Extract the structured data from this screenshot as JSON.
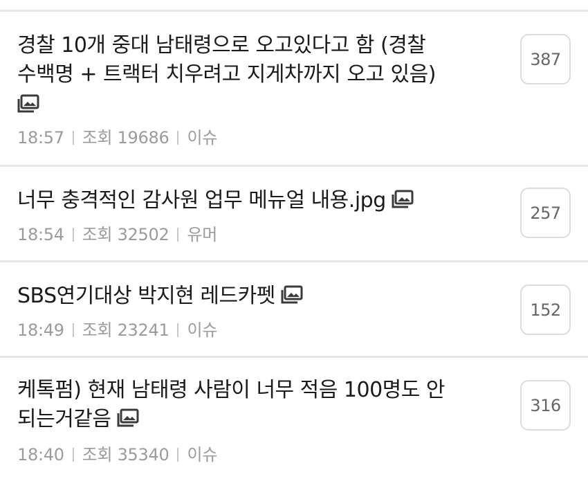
{
  "posts": [
    {
      "title_lines": [
        "경찰 10개 중대 남태령으로 오고있다고 함 (경찰",
        "수백명 + 트랙터 치우려고 지게차까지 오고 있음)"
      ],
      "has_image_icon": true,
      "time": "18:57",
      "views_label": "조회",
      "views": "19686",
      "category": "이슈",
      "comment_count": "387"
    },
    {
      "title_lines": [
        "너무 충격적인 감사원 업무 메뉴얼 내용.jpg"
      ],
      "has_image_icon": true,
      "time": "18:54",
      "views_label": "조회",
      "views": "32502",
      "category": "유머",
      "comment_count": "257"
    },
    {
      "title_lines": [
        "SBS연기대상 박지현 레드카펫"
      ],
      "has_image_icon": true,
      "time": "18:49",
      "views_label": "조회",
      "views": "23241",
      "category": "이슈",
      "comment_count": "152"
    },
    {
      "title_lines": [
        "케톡펌) 현재 남태령 사람이 너무 적음 100명도 안",
        "되는거같음"
      ],
      "has_image_icon": true,
      "time": "18:40",
      "views_label": "조회",
      "views": "35340",
      "category": "이슈",
      "comment_count": "316"
    }
  ],
  "icons": {
    "attachment": "image-icon"
  },
  "colors": {
    "title": "#1a1a1a",
    "meta": "#9b9b9b",
    "divider": "#e6e6e6",
    "count_border": "#dcdcdc",
    "count_text": "#666666"
  }
}
